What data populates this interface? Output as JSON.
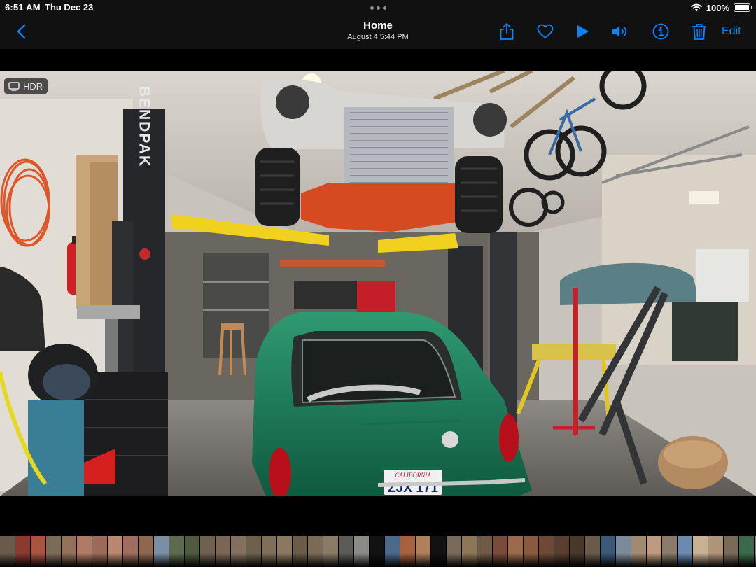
{
  "status_bar": {
    "time": "6:51 AM",
    "date": "Thu Dec 23",
    "battery_percent": "100%",
    "battery_level": 1.0
  },
  "nav": {
    "title": "Home",
    "subtitle": "August 4  5:44 PM",
    "edit_label": "Edit",
    "accent_color": "#0a84ff",
    "icons": [
      "back-chevron-icon",
      "share-icon",
      "heart-icon",
      "play-icon",
      "volume-icon",
      "info-icon",
      "trash-icon"
    ]
  },
  "photo": {
    "hdr_label": "HDR",
    "lift_brand": "BENDPAK",
    "plate_state": "CALIFORNIA",
    "plate_number": "ZJX 171"
  },
  "filmstrip": {
    "thumb_colors": [
      "#6b5a4a",
      "#8a3b30",
      "#a8543f",
      "#7d6b5a",
      "#94705a",
      "#b07a62",
      "#9e6a58",
      "#b88770",
      "#a06c5e",
      "#8f6650",
      "#7a8fa6",
      "#5d6a4e",
      "#4f5a3e",
      "#6f6050",
      "#7a6652",
      "#857060",
      "#6d604c",
      "#7f6e58",
      "#8c7860",
      "#6a5c48",
      "#7d6a55",
      "#8a7a66",
      "#5a5a58",
      "#8c8a86",
      "#121212",
      "#4a6a8a",
      "#a86040",
      "#b08058",
      "#121212",
      "#7a6a5a",
      "#8c7656",
      "#6e5a46",
      "#7a4a3a",
      "#9a6a4a",
      "#8a5a40",
      "#6e4a36",
      "#5a3e30",
      "#4a3828",
      "#6a5a4a",
      "#3a5a7a",
      "#7a8a9a",
      "#a08a70",
      "#c09a80",
      "#8a7a6a",
      "#6a8ab0",
      "#c8b090",
      "#b09478",
      "#7a6a5a",
      "#3a6a4a",
      "#8a8a8a",
      "#6a7a5a",
      "#4a6a3a",
      "#5a7a9a",
      "#9aa0a8",
      "#6a5a4a",
      "#8a6a4a"
    ]
  }
}
